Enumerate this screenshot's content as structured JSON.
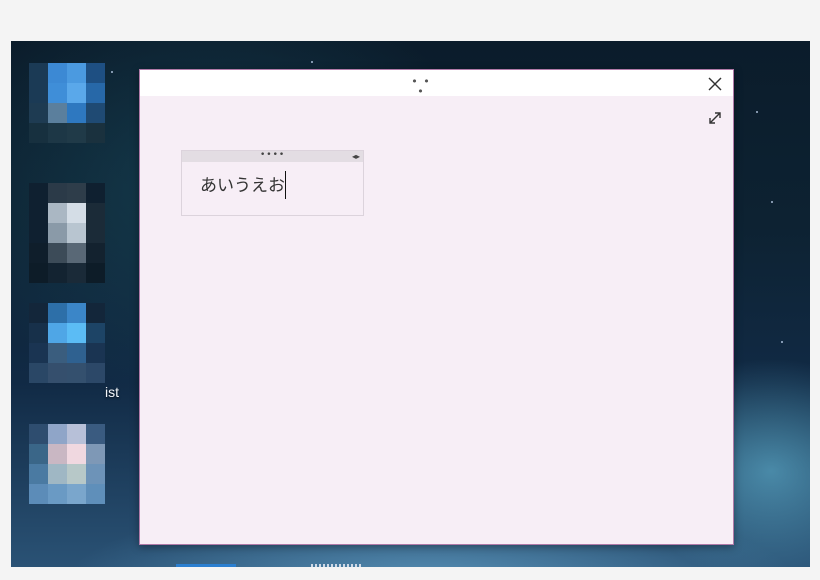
{
  "desktop": {
    "label_partial": "ist",
    "icons": [
      "blue-app-icon",
      "gray-app-icon",
      "light-blue-app-icon",
      "pink-app-icon"
    ]
  },
  "window": {
    "drag_handle": "• • •",
    "close_icon": "close-icon",
    "expand_icon": "expand-icon",
    "note": {
      "drag_handle": "••••",
      "resize_glyph": "◂▸",
      "text": "あいうえお"
    }
  },
  "colors": {
    "window_bg": "#f7eef6",
    "window_border": "#b07aa8",
    "titlebar_bg": "#ffffff",
    "note_header_bg": "#e3dde3"
  }
}
